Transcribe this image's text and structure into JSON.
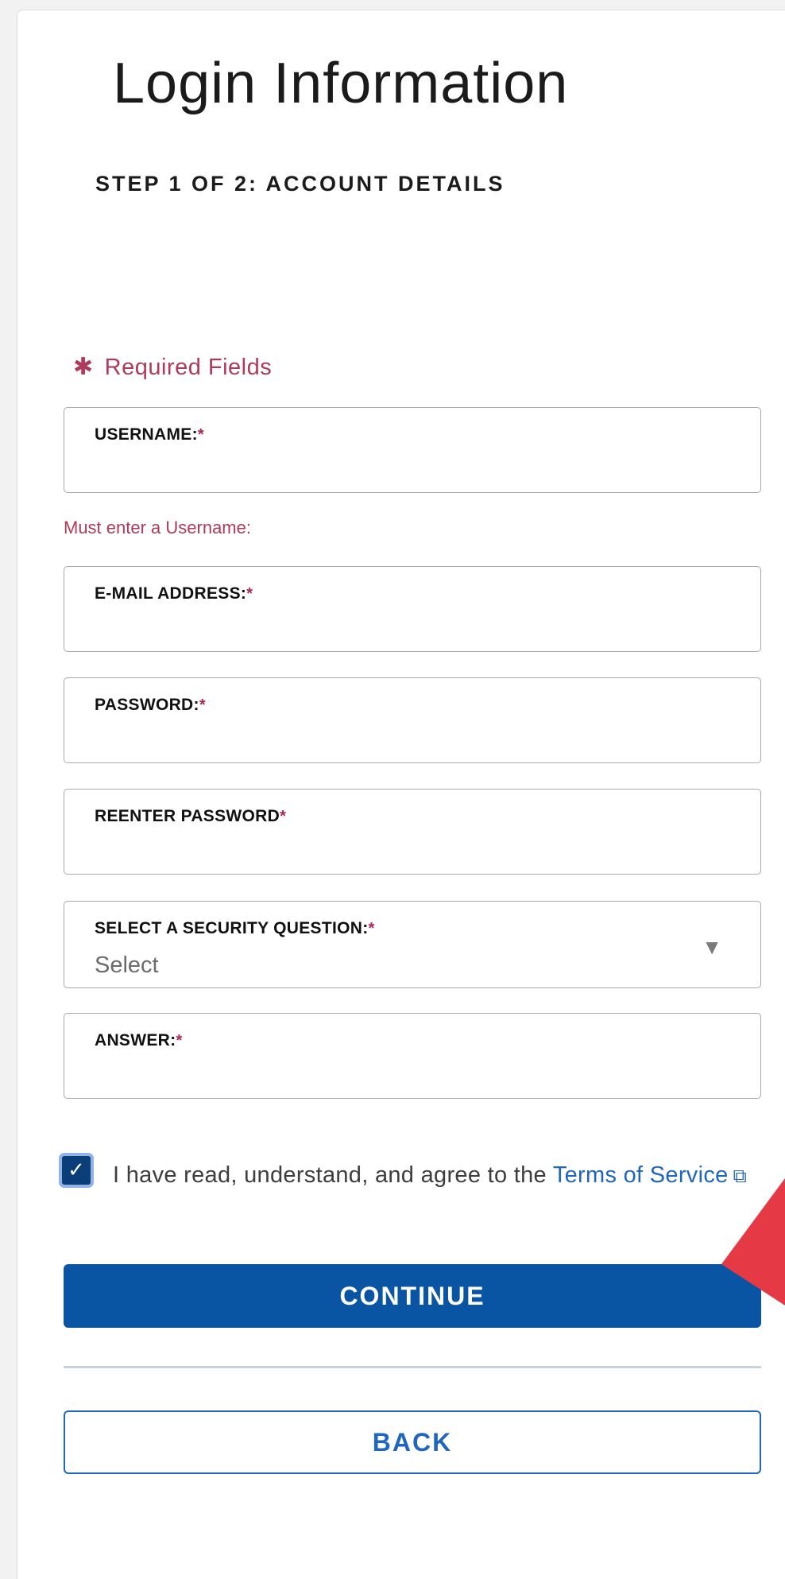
{
  "form": {
    "title": "Login Information",
    "step": "STEP 1 OF 2: ACCOUNT DETAILS",
    "required_note": "Required Fields",
    "required_star": "✱",
    "fields": [
      {
        "label": "USERNAME:",
        "value": ""
      },
      {
        "label": "E-MAIL ADDRESS:",
        "value": ""
      },
      {
        "label": "PASSWORD:",
        "value": ""
      },
      {
        "label": "REENTER PASSWORD",
        "value": ""
      },
      {
        "label": "SELECT A SECURITY QUESTION:",
        "value": "Select"
      },
      {
        "label": "ANSWER:",
        "value": ""
      }
    ],
    "asterisk": "*",
    "username_error": "Must enter a Username:",
    "agree_text": "I have read, understand, and agree to the ",
    "terms_link": "Terms of Service",
    "checkbox_checked": true,
    "continue_label": "CONTINUE",
    "back_label": "BACK"
  },
  "icons": {
    "checkmark": "check-icon",
    "external": "external-link-icon",
    "dropdown": "triangle-down-icon",
    "annotation": "red-arrow-annotation"
  },
  "colors": {
    "primary": "#0a54a4",
    "link": "#1f66c0",
    "error": "#b03a5b",
    "annotation": "#e53945"
  }
}
